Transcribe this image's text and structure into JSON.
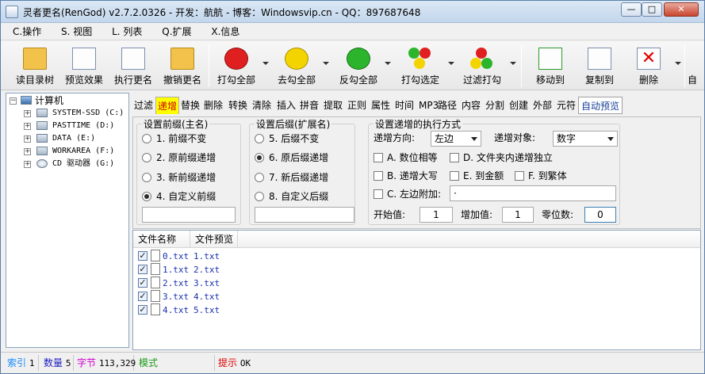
{
  "window": {
    "title": "灵者更名(RenGod) v2.7.2.0326 - 开发：航航 - 博客：Windowsvip.cn - QQ：897687648",
    "min_glyph": "—",
    "max_glyph": "□",
    "close_glyph": "✕"
  },
  "menu": [
    {
      "label": "C.操作"
    },
    {
      "label": "S. 视图"
    },
    {
      "label": "L. 列表"
    },
    {
      "label": "Q.扩展"
    },
    {
      "label": "X.信息"
    }
  ],
  "toolbar": {
    "items": [
      {
        "label": "读目录树",
        "icon": "open-folder-icon"
      },
      {
        "label": "预览效果",
        "icon": "preview-magnifier-icon"
      },
      {
        "label": "执行更名",
        "icon": "edit-document-icon"
      },
      {
        "label": "撤销更名",
        "icon": "undo-folder-icon"
      },
      {
        "label": "打勾全部",
        "icon": "red-ball-icon"
      },
      {
        "label": "去勾全部",
        "icon": "yellow-ball-icon"
      },
      {
        "label": "反勾全部",
        "icon": "green-ball-icon"
      },
      {
        "label": "打勾选定",
        "icon": "multi-ball-icon"
      },
      {
        "label": "过滤打勾",
        "icon": "filter-balls-icon"
      },
      {
        "label": "移动到",
        "icon": "move-to-icon"
      },
      {
        "label": "复制到",
        "icon": "copy-to-icon"
      },
      {
        "label": "删除",
        "icon": "delete-icon"
      },
      {
        "label": "自",
        "icon": "overflow-icon"
      }
    ],
    "colors": {
      "red": "#e02020",
      "yellow": "#f3d400",
      "green": "#2cb52c"
    }
  },
  "tree": {
    "root": "计算机",
    "drives": [
      {
        "label": "SYSTEM-SSD (C:)"
      },
      {
        "label": "PASTTIME (D:)"
      },
      {
        "label": "DATA (E:)"
      },
      {
        "label": "WORKAREA (F:)"
      },
      {
        "label": "CD 驱动器 (G:)"
      }
    ]
  },
  "tabs": [
    "过滤",
    "递增",
    "替换",
    "删除",
    "转换",
    "清除",
    "插入",
    "拼音",
    "提取",
    "正则",
    "属性",
    "时间",
    "MP3",
    "路径",
    "内容",
    "分割",
    "创建",
    "外部",
    "元符",
    "自动预览"
  ],
  "prefix": {
    "title": "设置前缀(主名)",
    "options": [
      "1. 前缀不变",
      "2. 原前缀递增",
      "3. 新前缀递增",
      "4. 自定义前缀"
    ],
    "selected": 3,
    "custom_value": ""
  },
  "suffix": {
    "title": "设置后缀(扩展名)",
    "options": [
      "5. 后缀不变",
      "6. 原后缀递增",
      "7. 新后缀递增",
      "8. 自定义后缀"
    ],
    "selected": 1,
    "custom_value": ""
  },
  "increment": {
    "title": "设置递增的执行方式",
    "direction_label": "递增方向:",
    "direction_value": "左边",
    "target_label": "递增对象:",
    "target_value": "数字",
    "checks": [
      {
        "label": "A. 数位相等",
        "checked": false
      },
      {
        "label": "D. 文件夹内递增独立",
        "checked": false
      },
      {
        "label": "B. 递增大写",
        "checked": false
      },
      {
        "label": "E. 到金额",
        "checked": false
      },
      {
        "label": "F. 到繁体",
        "checked": false
      },
      {
        "label": "C. 左边附加:",
        "checked": false
      }
    ],
    "left_append_value": "·",
    "start_label": "开始值:",
    "start_value": "1",
    "step_label": "增加值:",
    "step_value": "1",
    "digits_label": "零位数:",
    "digits_value": "0"
  },
  "filelist": {
    "columns": [
      "文件名称",
      "文件预览"
    ],
    "rows": [
      {
        "name": "0.txt",
        "preview": "1.txt",
        "checked": true
      },
      {
        "name": "1.txt",
        "preview": "2.txt",
        "checked": true
      },
      {
        "name": "2.txt",
        "preview": "3.txt",
        "checked": true
      },
      {
        "name": "3.txt",
        "preview": "4.txt",
        "checked": true
      },
      {
        "name": "4.txt",
        "preview": "5.txt",
        "checked": true
      }
    ],
    "name_color": "#1a30b0"
  },
  "status": {
    "index_label": "索引",
    "index_value": "1",
    "count_label": "数量",
    "count_value": "5",
    "bytes_label": "字节",
    "bytes_value": "113,329",
    "mode_label": "模式",
    "mode_value": "",
    "tip_label": "提示",
    "tip_value": "OK",
    "colors": {
      "index": "#1a8cff",
      "count": "#2020c0",
      "bytes": "#d000d0",
      "mode": "#1a9a1a",
      "tip": "#e00000"
    }
  }
}
